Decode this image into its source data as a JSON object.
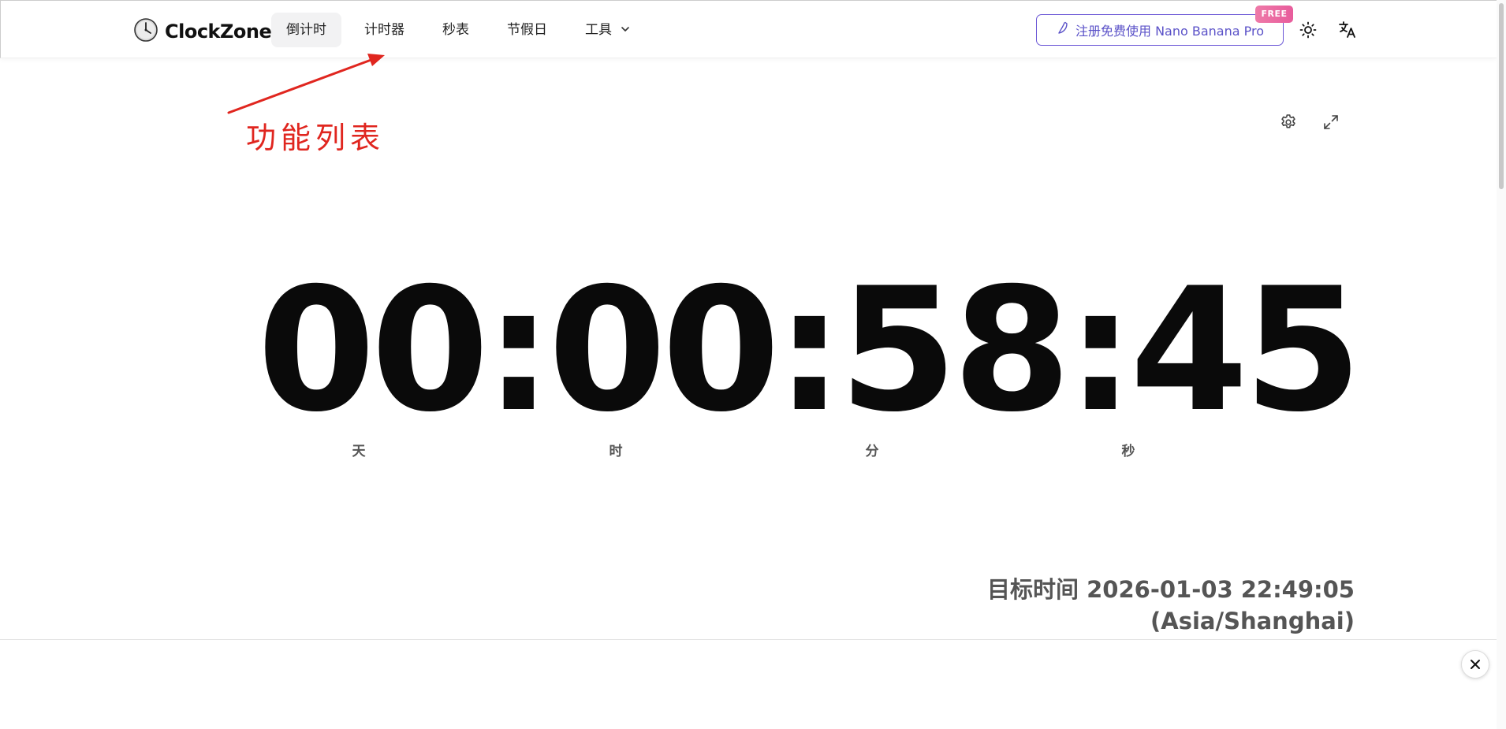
{
  "header": {
    "logo_text": "ClockZone",
    "nav": [
      {
        "label": "倒计时",
        "active": true
      },
      {
        "label": "计时器"
      },
      {
        "label": "秒表"
      },
      {
        "label": "节假日"
      },
      {
        "label": "工具"
      }
    ],
    "promo_label": "注册免费使用 Nano Banana Pro",
    "promo_badge": "FREE",
    "theme_icon": "sun-icon",
    "language_icon": "translate-icon"
  },
  "annotation": {
    "text": "功能列表",
    "color": "#e0261f"
  },
  "tools": {
    "settings_icon": "gear-icon",
    "fullscreen_icon": "expand-icon"
  },
  "countdown": {
    "days": "00",
    "hours": "00",
    "minutes": "58",
    "seconds": "45",
    "separator": ":",
    "units": [
      "天",
      "时",
      "分",
      "秒"
    ]
  },
  "target": {
    "line1": "目标时间 2026-01-03 22:49:05",
    "line2": "(Asia/Shanghai)"
  },
  "ad": {
    "close_icon": "close-icon"
  },
  "colors": {
    "accent": "#6b57d6",
    "badge": "#e85c9c",
    "digits": "#0a0a0a"
  }
}
